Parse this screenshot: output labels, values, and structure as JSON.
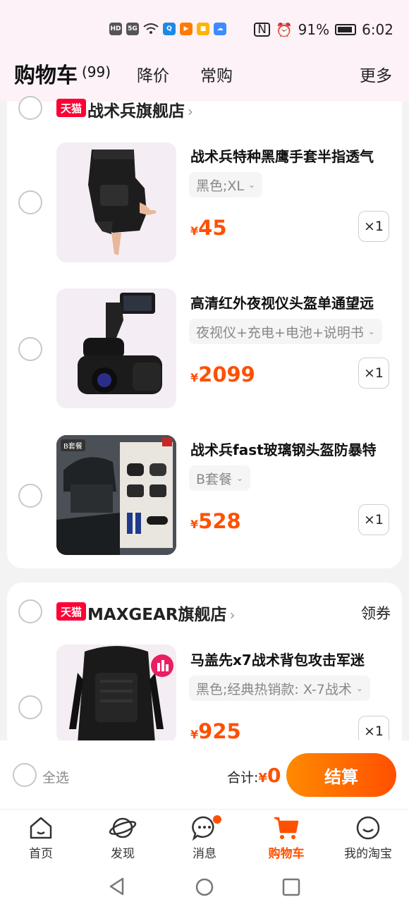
{
  "status_bar": {
    "left_chips": [
      {
        "label": "HD",
        "color": "#555555"
      },
      {
        "label": "5G",
        "color": "#555555"
      },
      {
        "label": "Q",
        "color": "#1e88e5"
      },
      {
        "label": "▶",
        "color": "#ff7a00"
      },
      {
        "label": "■",
        "color": "#ffb300"
      },
      {
        "label": "☁",
        "color": "#3d8bff"
      }
    ],
    "battery": "91%",
    "time": "6:02"
  },
  "header": {
    "title": "购物车",
    "count": "(99)",
    "tabs": [
      "降价",
      "常购"
    ],
    "more": "更多"
  },
  "stores": [
    {
      "badge": "天猫",
      "name": "战术兵旗舰店",
      "chevron": "›",
      "items": [
        {
          "title": "战术兵特种黑鹰手套半指透气",
          "sku": "黑色;XL",
          "currency": "¥",
          "price": "45",
          "qty": "×1",
          "image": "glove-image"
        },
        {
          "title": "高清红外夜视仪头盔单通望远",
          "sku": "夜视仪+充电+电池+说明书",
          "currency": "¥",
          "price": "2099",
          "qty": "×1",
          "image": "night-vision-image"
        },
        {
          "title": "战术兵fast玻璃钢头盔防暴特",
          "sku": "B套餐",
          "currency": "¥",
          "price": "528",
          "qty": "×1",
          "image": "helmet-image",
          "image_tag": "B套餐"
        }
      ]
    },
    {
      "badge": "天猫",
      "name": "MAXGEAR旗舰店",
      "chevron": "›",
      "coupon": "领券",
      "items": [
        {
          "title": "马盖先x7战术背包攻击军迷",
          "sku": "黑色;经典热销款: X-7战术",
          "currency": "¥",
          "price": "925",
          "qty": "×1",
          "image": "backpack-image"
        }
      ]
    }
  ],
  "checkout": {
    "select_all": "全选",
    "total_label": "合计:",
    "currency": "¥",
    "total": "0",
    "button": "结算"
  },
  "tabbar": [
    {
      "label": "首页",
      "icon": "home-icon"
    },
    {
      "label": "发现",
      "icon": "planet-icon"
    },
    {
      "label": "消息",
      "icon": "message-icon"
    },
    {
      "label": "购物车",
      "icon": "cart-icon"
    },
    {
      "label": "我的淘宝",
      "icon": "smile-icon"
    }
  ],
  "colors": {
    "accent": "#ff5000",
    "tmall_red": "#ff0036"
  }
}
